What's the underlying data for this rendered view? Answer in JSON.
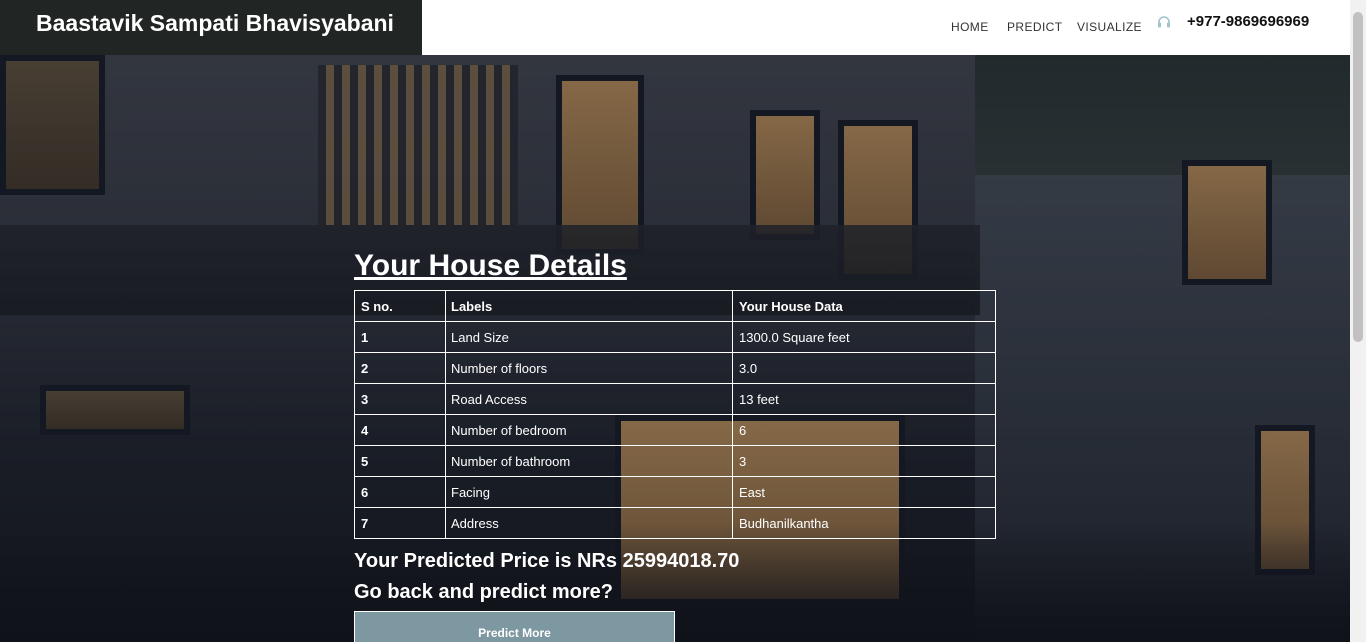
{
  "header": {
    "brand": "Baastavik Sampati Bhavisyabani",
    "nav": {
      "home": "HOME",
      "predict": "PREDICT",
      "visualize": "VISUALIZE"
    },
    "phone_icon": "headset-icon",
    "phone": "+977-9869696969"
  },
  "main": {
    "title": "Your House Details",
    "table": {
      "headers": [
        "S no.",
        "Labels",
        "Your House Data"
      ],
      "rows": [
        {
          "sn": "1",
          "label": "Land Size",
          "value": "1300.0 Square feet"
        },
        {
          "sn": "2",
          "label": "Number of floors",
          "value": "3.0"
        },
        {
          "sn": "3",
          "label": "Road Access",
          "value": "13 feet"
        },
        {
          "sn": "4",
          "label": "Number of bedroom",
          "value": "6"
        },
        {
          "sn": "5",
          "label": "Number of bathroom",
          "value": "3"
        },
        {
          "sn": "6",
          "label": "Facing",
          "value": "East"
        },
        {
          "sn": "7",
          "label": "Address",
          "value": "Budhanilkantha"
        }
      ]
    },
    "predicted_text": "Your Predicted Price is NRs 25994018.70",
    "go_back_text": "Go back and predict more?",
    "predict_more_label": "Predict More"
  },
  "colors": {
    "brand_bg": "#212624",
    "button_bg": "#7d98a0",
    "header_bg": "#ffffff"
  }
}
